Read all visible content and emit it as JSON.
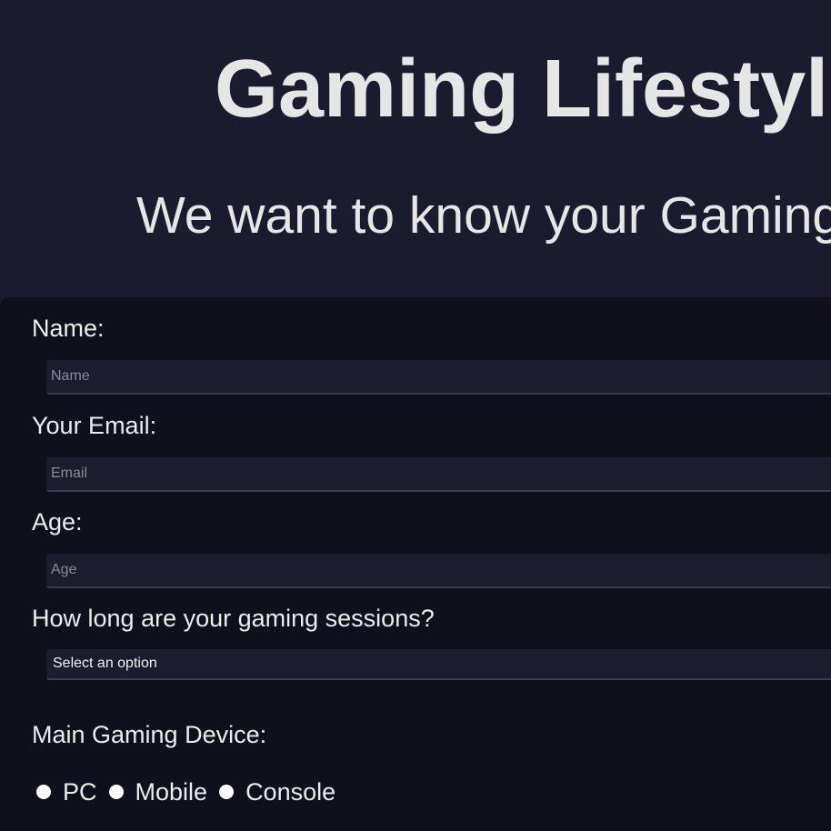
{
  "header": {
    "title": "Gaming Lifestyle",
    "subtitle": "We want to know your Gaming Lifestyle"
  },
  "form": {
    "name": {
      "label": "Name:",
      "placeholder": "Name",
      "value": ""
    },
    "email": {
      "label": "Your Email:",
      "placeholder": "Email",
      "value": ""
    },
    "age": {
      "label": "Age:",
      "placeholder": "Age",
      "value": ""
    },
    "sessions": {
      "label": "How long are your gaming sessions?",
      "selected": "Select an option"
    },
    "device": {
      "label": "Main Gaming Device:",
      "options": [
        "PC",
        "Mobile",
        "Console"
      ]
    }
  },
  "colors": {
    "background": "#1b1b2f",
    "form_background": "#10101c",
    "input_background": "#1c1c2e",
    "text": "#e6e6e6"
  }
}
